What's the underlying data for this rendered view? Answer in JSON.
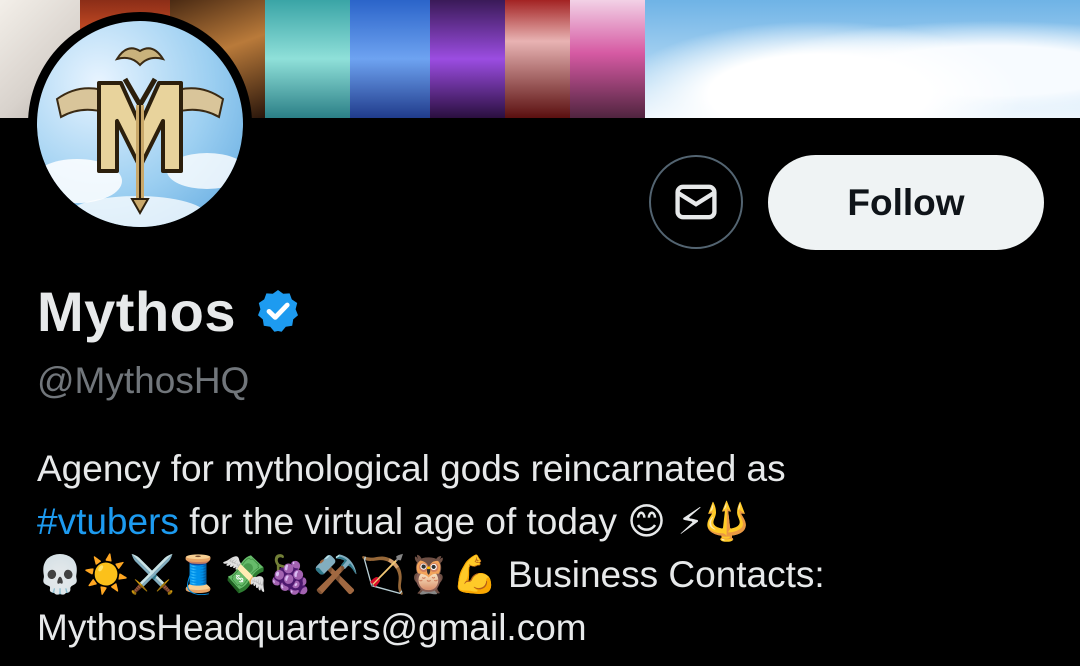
{
  "profile": {
    "display_name": "Mythos",
    "handle": "@MythosHQ",
    "verified": true,
    "follow_label": "Follow",
    "message_button": "envelope-icon"
  },
  "bio": {
    "line1": "Agency for mythological gods reincarnated as",
    "hashtag": "#vtubers",
    "line2_rest": " for the virtual age of today",
    "line2_emoji": "😊 ⚡🔱",
    "line3_emoji": "💀☀️⚔️🧵💸🍇⚒️🏹🦉💪",
    "line3_text": " Business Contacts:",
    "line4": "MythosHeadquarters@gmail.com"
  },
  "colors": {
    "background": "#000000",
    "text_primary": "#e7e9ea",
    "text_secondary": "#71767b",
    "link": "#1d9bf0",
    "verified": "#1d9bf0",
    "follow_bg": "#eff3f4"
  }
}
